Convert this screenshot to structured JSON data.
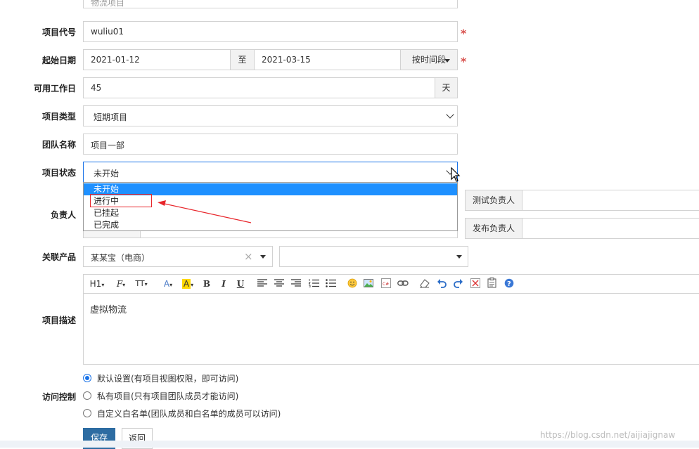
{
  "form": {
    "top_field": {
      "value": "物流项目"
    },
    "project_code": {
      "label": "项目代号",
      "value": "wuliu01"
    },
    "date_range": {
      "label": "起始日期",
      "start": "2021-01-12",
      "separator": "至",
      "end": "2021-03-15",
      "button": "按时间段"
    },
    "workdays": {
      "label": "可用工作日",
      "value": "45",
      "unit": "天"
    },
    "project_type": {
      "label": "项目类型",
      "value": "短期项目"
    },
    "team_name": {
      "label": "团队名称",
      "value": "项目一部"
    },
    "status": {
      "label": "项目状态",
      "value": "未开始",
      "options": [
        "未开始",
        "进行中",
        "已挂起",
        "已完成"
      ],
      "highlighted_index": 0
    },
    "owner": {
      "label": "负责人",
      "test_owner_label": "测试负责人",
      "release_owner_label": "发布负责人"
    },
    "related_product": {
      "label": "关联产品",
      "value": "某某宝（电商）",
      "second_value": ""
    },
    "description": {
      "label": "项目描述",
      "content": "虚拟物流"
    },
    "access_control": {
      "label": "访问控制",
      "options": [
        "默认设置(有项目视图权限，即可访问)",
        "私有项目(只有项目团队成员才能访问)",
        "自定义白名单(团队成员和白名单的成员可以访问)"
      ],
      "selected_index": 0
    },
    "buttons": {
      "save": "保存",
      "back": "返回"
    },
    "required_mark": "*"
  },
  "editor_toolbar": {
    "heading": "H1",
    "font": "F",
    "font_size": "TT",
    "font_color": "A",
    "highlight": "A",
    "bold": "B",
    "italic": "I",
    "underline": "U"
  },
  "watermark": "https://blog.csdn.net/aijiajignaw",
  "colors": {
    "primary": "#2d6ca2",
    "selected_option": "#1e90ff",
    "required": "#d9534f",
    "annotation": "#e8262b"
  }
}
